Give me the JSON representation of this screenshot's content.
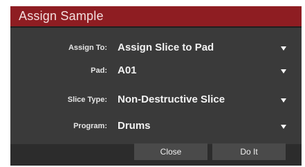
{
  "dialog": {
    "title": "Assign Sample",
    "fields": [
      {
        "label": "Assign To:",
        "value": "Assign Slice to Pad"
      },
      {
        "label": "Pad:",
        "value": "A01"
      },
      {
        "label": "Slice Type:",
        "value": "Non-Destructive Slice"
      },
      {
        "label": "Program:",
        "value": "Drums"
      }
    ],
    "buttons": {
      "close": "Close",
      "do_it": "Do It"
    }
  },
  "colors": {
    "titlebar": "#8e1d22",
    "body": "#3a3a3a",
    "footer": "#2c2c2c",
    "button": "#4a4a4a"
  }
}
